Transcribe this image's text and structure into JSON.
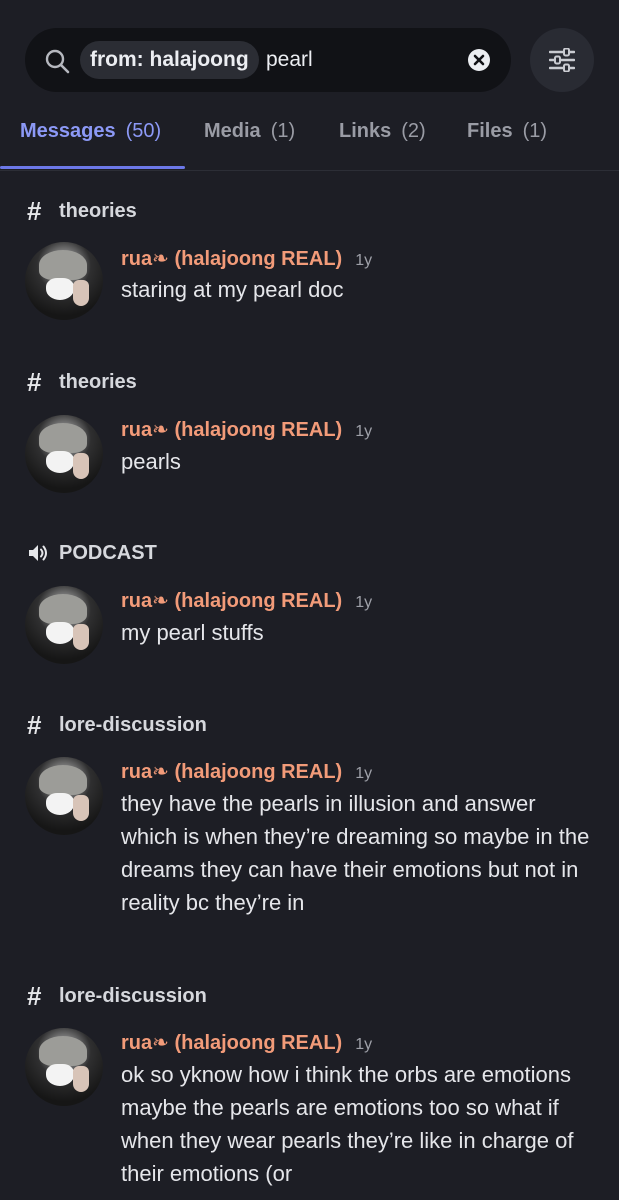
{
  "search": {
    "filter_chip": "from: halajoong",
    "query": "pearl"
  },
  "tabs": [
    {
      "label": "Messages",
      "count": "(50)"
    },
    {
      "label": "Media",
      "count": "(1)"
    },
    {
      "label": "Links",
      "count": "(2)"
    },
    {
      "label": "Files",
      "count": "(1)"
    }
  ],
  "colors": {
    "background": "#1d1e25",
    "accent": "#8c99f6",
    "author": "#f29b79"
  },
  "results": [
    {
      "channel_icon": "hash-icon",
      "channel": "theories",
      "author": "rua❧ (halajoong REAL)",
      "time": "1y",
      "text": "staring at my pearl doc"
    },
    {
      "channel_icon": "hash-icon",
      "channel": "theories",
      "author": "rua❧ (halajoong REAL)",
      "time": "1y",
      "text": "pearls"
    },
    {
      "channel_icon": "speaker-icon",
      "channel": "PODCAST",
      "author": "rua❧ (halajoong REAL)",
      "time": "1y",
      "text": "my pearl stuffs"
    },
    {
      "channel_icon": "hash-icon",
      "channel": "lore-discussion",
      "author": "rua❧ (halajoong REAL)",
      "time": "1y",
      "text": "they have the pearls in illusion and answer which is when they’re dreaming so maybe in the dreams they can have their emotions but not in reality bc they’re in"
    },
    {
      "channel_icon": "hash-icon",
      "channel": "lore-discussion",
      "author": "rua❧ (halajoong REAL)",
      "time": "1y",
      "text": "ok so yknow how i think the orbs are emotions maybe the pearls are emotions too so what if when they wear pearls they’re like in charge of their emotions (or"
    }
  ]
}
